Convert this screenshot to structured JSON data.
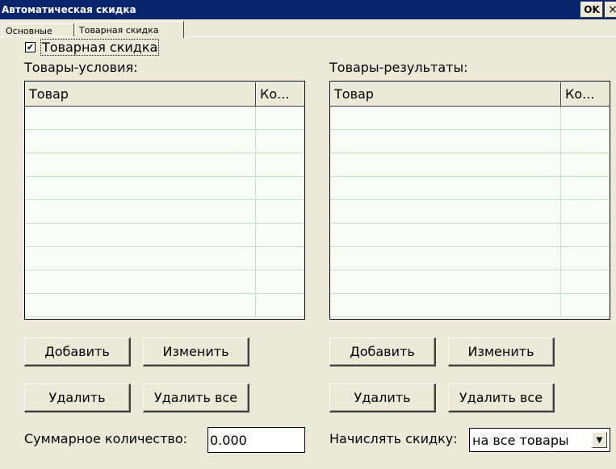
{
  "window": {
    "title": "Автоматическая скидка",
    "ok_label": "OK",
    "close_label": "×"
  },
  "tabs": [
    {
      "label": "Основные",
      "active": false
    },
    {
      "label": "Товарная скидка",
      "active": true
    }
  ],
  "goods_discount": {
    "checkbox_label": "Товарная скидка",
    "checked": true
  },
  "conditions": {
    "label": "Товары-условия:",
    "columns": [
      "Товар",
      "Ко..."
    ],
    "rows": [],
    "buttons": {
      "add": "Добавить",
      "edit": "Изменить",
      "delete": "Удалить",
      "delete_all": "Удалить все"
    }
  },
  "results": {
    "label": "Товары-результаты:",
    "columns": [
      "Товар",
      "Ко..."
    ],
    "rows": [],
    "buttons": {
      "add": "Добавить",
      "edit": "Изменить",
      "delete": "Удалить",
      "delete_all": "Удалить все"
    }
  },
  "total": {
    "label": "Суммарное количество:",
    "value": "0.000"
  },
  "apply": {
    "label": "Начислять скидку:",
    "selected": "на все товары"
  },
  "icons": {
    "checkmark": "check-icon",
    "dropdown": "triangle-down-icon"
  }
}
